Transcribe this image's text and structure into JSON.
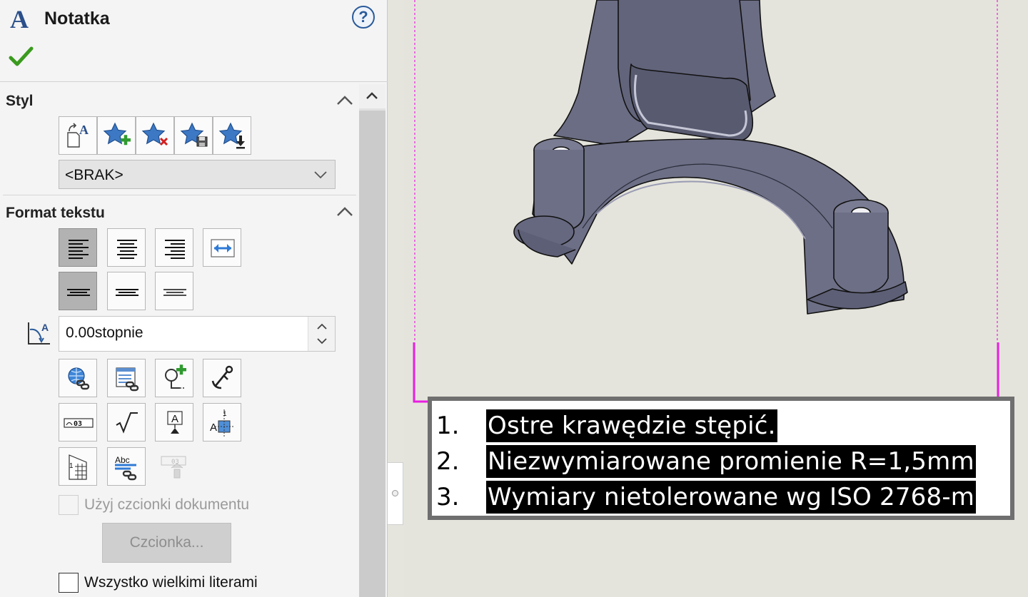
{
  "panel": {
    "title": "Notatka",
    "help_label": "?",
    "sections": {
      "style": {
        "title": "Styl",
        "select_value": "<BRAK>",
        "buttons": [
          "apply-style",
          "add-style",
          "delete-style",
          "save-style",
          "load-style"
        ]
      },
      "text_format": {
        "title": "Format tekstu",
        "angle_value": "0.00stopnie",
        "use_document_font_label": "Użyj czcionki dokumentu",
        "font_button_label": "Czcionka...",
        "all_caps_label": "Wszystko wielkimi literami"
      }
    }
  },
  "icons": {
    "sample_zero_three": "03",
    "square_root": "√",
    "text_a": "A",
    "abc": "Abc",
    "one": "1"
  },
  "note": {
    "lines": [
      {
        "num": "1.",
        "text": "Ostre krawędzie stępić."
      },
      {
        "num": "2.",
        "text": "Niezwymiarowane promienie R=1,5mm"
      },
      {
        "num": "3.",
        "text": "Wymiary  nietolerowane wg ISO 2768-m"
      }
    ]
  },
  "colors": {
    "accent_blue": "#2a5a9a",
    "confirm_green": "#3a9a1e",
    "sheet_boundary": "#e81ee0",
    "model_fill": "#6d6f86",
    "viewport_bg": "#e5e4dc"
  }
}
